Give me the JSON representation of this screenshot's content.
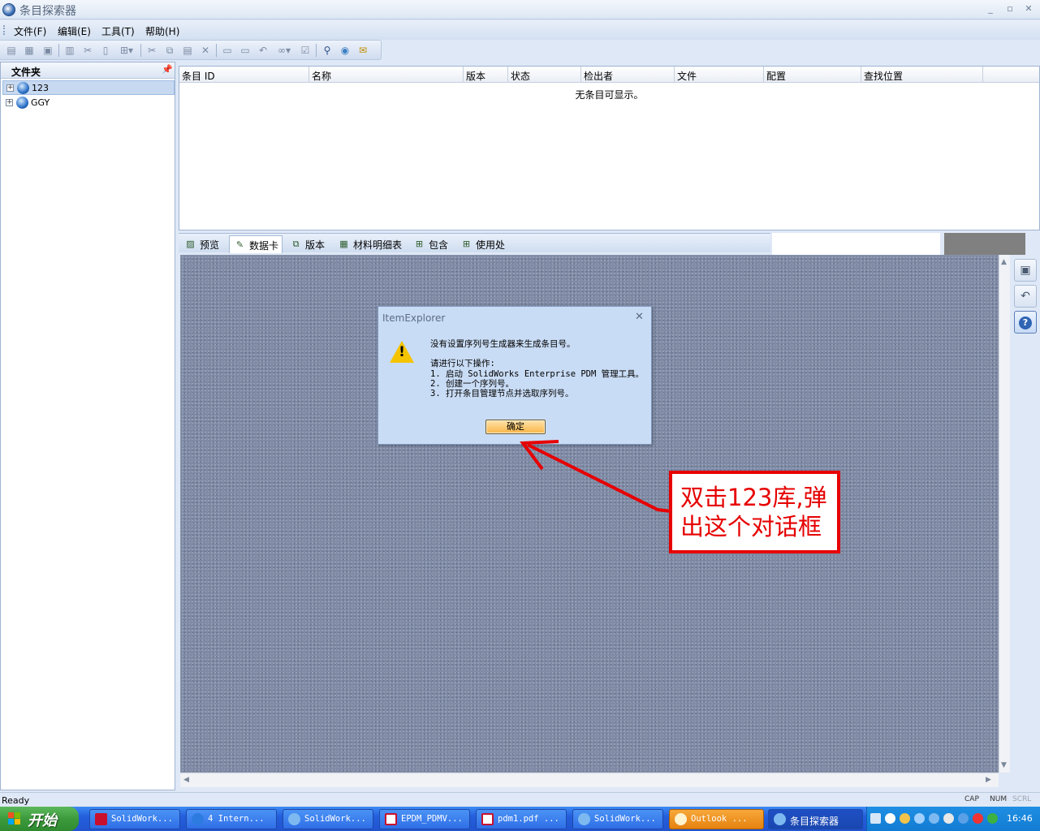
{
  "window": {
    "title": "条目探索器"
  },
  "menu": [
    "文件(F)",
    "编辑(E)",
    "工具(T)",
    "帮助(H)"
  ],
  "folder_panel": {
    "title": "文件夹",
    "items": [
      {
        "label": "123",
        "selected": true
      },
      {
        "label": "GGY",
        "selected": false
      }
    ]
  },
  "list": {
    "columns": [
      "条目 ID",
      "名称",
      "版本",
      "状态",
      "检出者",
      "文件",
      "配置",
      "查找位置"
    ],
    "empty_message": "无条目可显示。"
  },
  "tabs": [
    {
      "label": "预览",
      "icon": "preview-icon"
    },
    {
      "label": "数据卡",
      "icon": "datacard-icon",
      "active": true
    },
    {
      "label": "版本",
      "icon": "version-icon"
    },
    {
      "label": "材料明细表",
      "icon": "bom-icon"
    },
    {
      "label": "包含",
      "icon": "contains-icon"
    },
    {
      "label": "使用处",
      "icon": "where-used-icon"
    }
  ],
  "dialog": {
    "title": "ItemExplorer",
    "message": "没有设置序列号生成器来生成条目号。",
    "instructions_header": "请进行以下操作:",
    "steps": [
      "1. 启动 SolidWorks Enterprise PDM 管理工具。",
      "2. 创建一个序列号。",
      "3. 打开条目管理节点并选取序列号。"
    ],
    "ok_label": "确定"
  },
  "annotation": {
    "line1": "双击123库,弹",
    "line2": "出这个对话框",
    "color": "#e60000"
  },
  "status": {
    "text": "Ready",
    "indicators": [
      "CAP",
      "NUM",
      "SCRL"
    ]
  },
  "taskbar": {
    "start_label": "开始",
    "buttons": [
      {
        "label": "SolidWork...",
        "icon": "solidworks-icon"
      },
      {
        "label": "4 Intern...",
        "icon": "ie-icon"
      },
      {
        "label": "SolidWork...",
        "icon": "pdm-icon"
      },
      {
        "label": "EPDM_PDMV...",
        "icon": "pdf-icon"
      },
      {
        "label": "pdm1.pdf ...",
        "icon": "pdf-icon"
      },
      {
        "label": "SolidWork...",
        "icon": "pdm-icon"
      },
      {
        "label": "Outlook ...",
        "icon": "outlook-icon"
      },
      {
        "label": "条目探索器",
        "icon": "item-explorer-icon",
        "active": true
      }
    ],
    "clock": "16:46"
  }
}
